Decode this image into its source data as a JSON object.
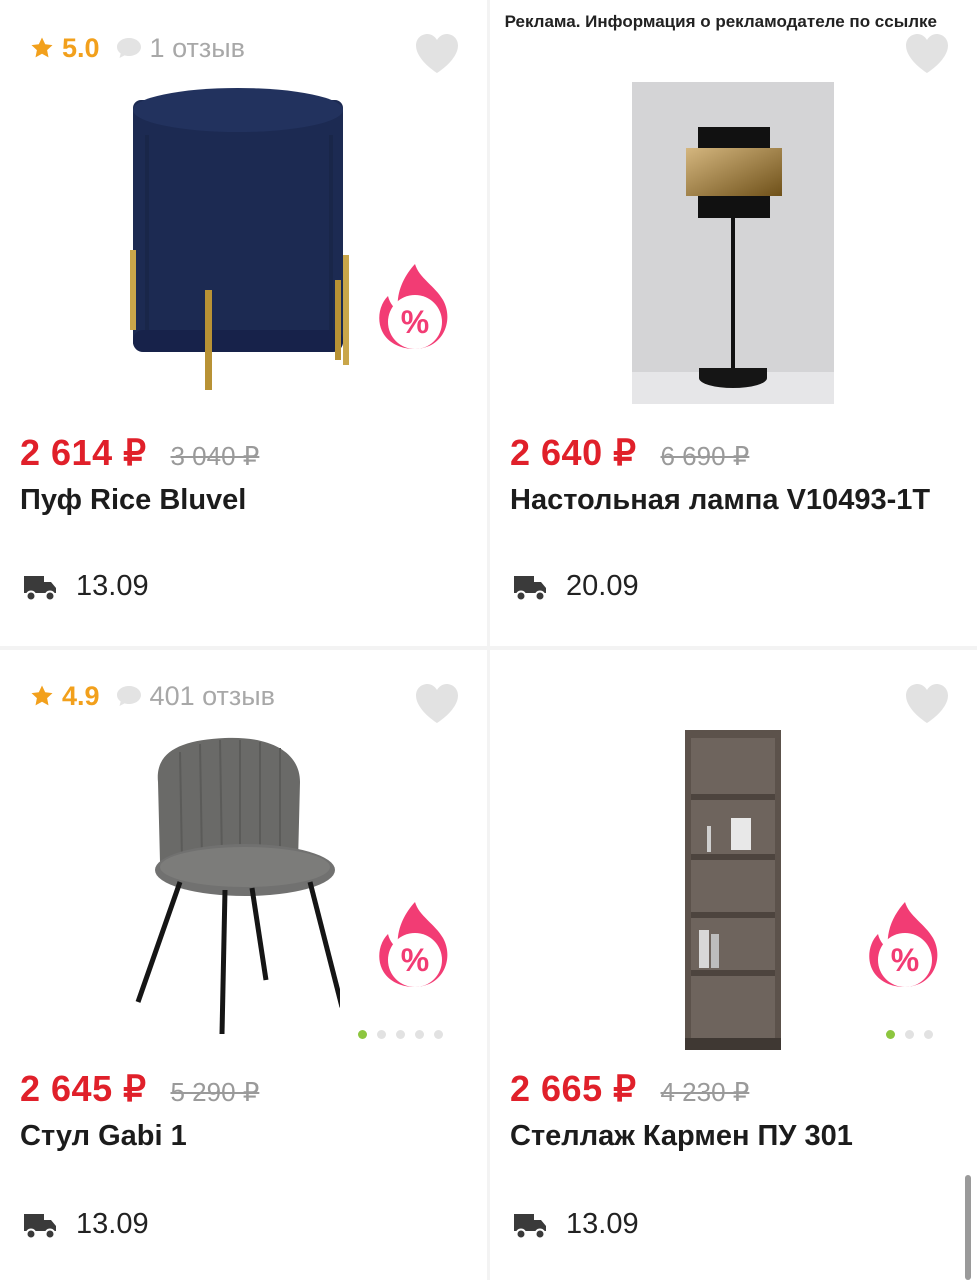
{
  "ad_notice": "Реклама. Информация о рекламодателе по ссылке",
  "currency": "₽",
  "colors": {
    "price": "#e0202a",
    "rating": "#f2a01c",
    "sale": "#f23c74",
    "dot_active": "#8dc63f"
  },
  "products": [
    {
      "rating": "5.0",
      "reviews": "1 отзыв",
      "image": "navy-velvet-pouf",
      "price": "2 614 ₽",
      "old_price": "3 040 ₽",
      "title": "Пуф Rice Bluvel",
      "delivery": "13.09",
      "sale_badge": "%"
    },
    {
      "image": "black-gold-table-lamp",
      "price": "2 640 ₽",
      "old_price": "6 690 ₽",
      "title": "Настольная лампа V10493-1T",
      "delivery": "20.09"
    },
    {
      "rating": "4.9",
      "reviews": "401 отзыв",
      "image": "grey-velvet-chair",
      "price": "2 645 ₽",
      "old_price": "5 290 ₽",
      "title": "Стул Gabi 1",
      "delivery": "13.09",
      "sale_badge": "%",
      "image_count": 5
    },
    {
      "image": "brown-corner-shelf",
      "price": "2 665 ₽",
      "old_price": "4 230 ₽",
      "title": "Стеллаж Кармен ПУ 301",
      "delivery": "13.09",
      "sale_badge": "%",
      "image_count": 3
    }
  ]
}
